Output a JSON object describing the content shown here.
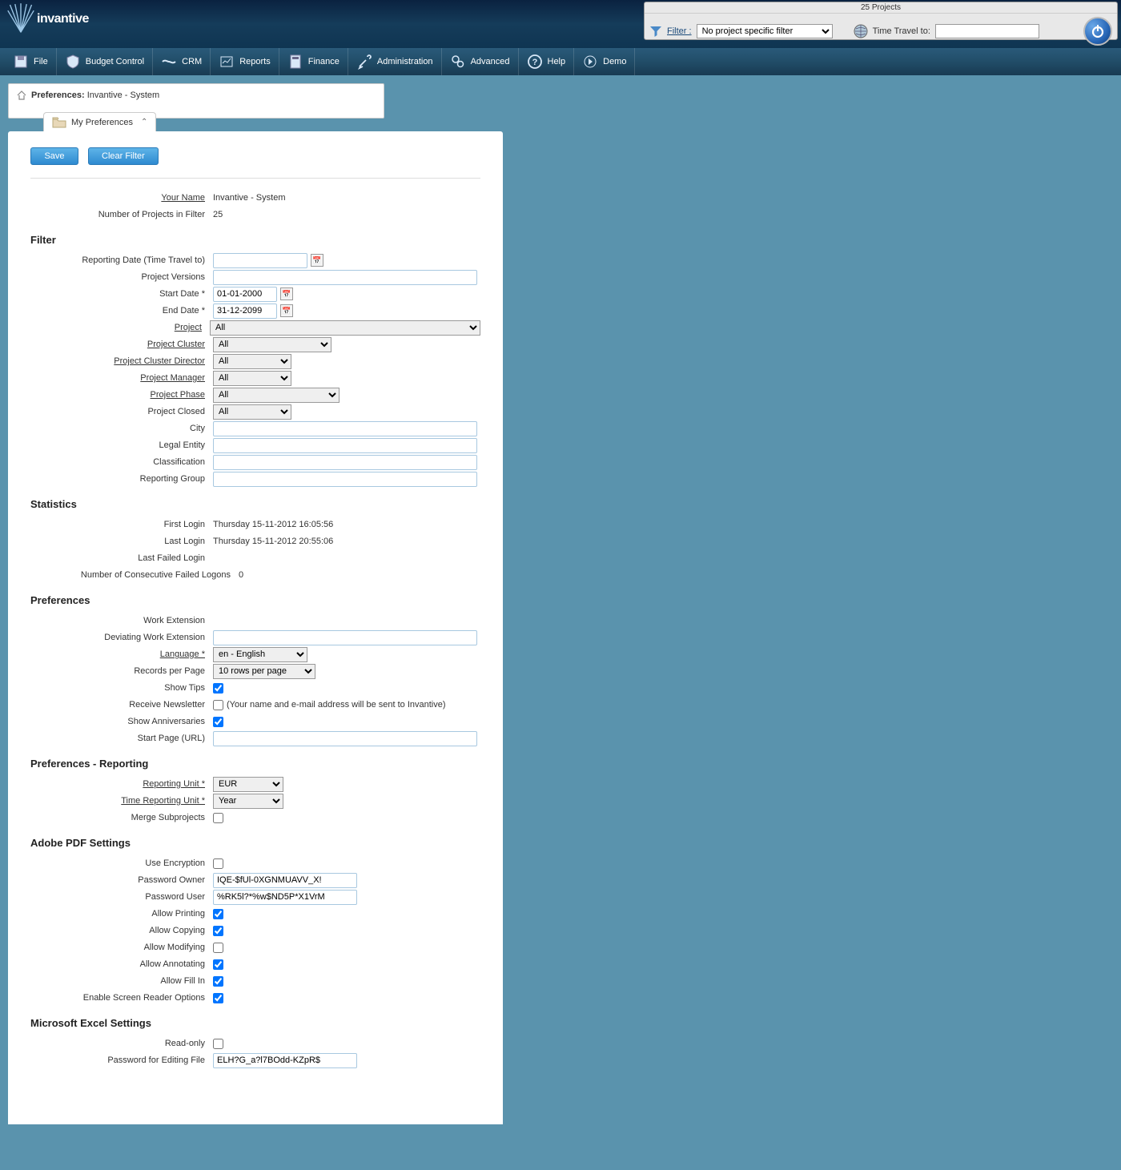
{
  "header": {
    "logo_text": "invantive",
    "projects_count": "25 Projects",
    "filter_label": "Filter :",
    "filter_value": "No project specific filter",
    "time_travel_label": "Time Travel to:",
    "time_travel_value": ""
  },
  "menu": {
    "items": [
      {
        "label": "File"
      },
      {
        "label": "Budget Control"
      },
      {
        "label": "CRM"
      },
      {
        "label": "Reports"
      },
      {
        "label": "Finance"
      },
      {
        "label": "Administration"
      },
      {
        "label": "Advanced"
      },
      {
        "label": "Help"
      },
      {
        "label": "Demo"
      }
    ]
  },
  "breadcrumb": {
    "label": "Preferences:",
    "value": "Invantive - System"
  },
  "tab": {
    "label": "My Preferences"
  },
  "buttons": {
    "save": "Save",
    "clear_filter": "Clear Filter"
  },
  "info": {
    "your_name_label": "Your Name",
    "your_name_value": "Invantive - System",
    "num_projects_label": "Number of Projects in Filter",
    "num_projects_value": "25"
  },
  "sections": {
    "filter": "Filter",
    "statistics": "Statistics",
    "preferences": "Preferences",
    "prefs_reporting": "Preferences - Reporting",
    "pdf": "Adobe PDF Settings",
    "excel": "Microsoft Excel Settings"
  },
  "filter": {
    "reporting_date_label": "Reporting Date (Time Travel to)",
    "reporting_date_value": "",
    "project_versions_label": "Project Versions",
    "project_versions_value": "",
    "start_date_label": "Start Date *",
    "start_date_value": "01-01-2000",
    "end_date_label": "End Date *",
    "end_date_value": "31-12-2099",
    "project_label": "Project",
    "project_value": "All",
    "project_cluster_label": "Project Cluster",
    "project_cluster_value": "All",
    "project_cluster_director_label": "Project Cluster Director",
    "project_cluster_director_value": "All",
    "project_manager_label": "Project Manager",
    "project_manager_value": "All",
    "project_phase_label": "Project Phase",
    "project_phase_value": "All",
    "project_closed_label": "Project Closed",
    "project_closed_value": "All",
    "city_label": "City",
    "city_value": "",
    "legal_entity_label": "Legal Entity",
    "legal_entity_value": "",
    "classification_label": "Classification",
    "classification_value": "",
    "reporting_group_label": "Reporting Group",
    "reporting_group_value": ""
  },
  "statistics": {
    "first_login_label": "First Login",
    "first_login_value": "Thursday 15-11-2012 16:05:56",
    "last_login_label": "Last Login",
    "last_login_value": "Thursday 15-11-2012 20:55:06",
    "last_failed_login_label": "Last Failed Login",
    "last_failed_login_value": "",
    "failed_logons_label": "Number of Consecutive Failed Logons",
    "failed_logons_value": "0"
  },
  "prefs": {
    "work_ext_label": "Work Extension",
    "work_ext_value": "",
    "dev_work_ext_label": "Deviating Work Extension",
    "dev_work_ext_value": "",
    "language_label": "Language *",
    "language_value": "en - English",
    "records_label": "Records per Page",
    "records_value": "10 rows per page",
    "show_tips_label": "Show Tips",
    "receive_newsletter_label": "Receive Newsletter",
    "newsletter_note": "(Your name and e-mail address will be sent to Invantive)",
    "show_anniv_label": "Show Anniversaries",
    "start_page_label": "Start Page (URL)",
    "start_page_value": ""
  },
  "reporting": {
    "reporting_unit_label": "Reporting Unit *",
    "reporting_unit_value": "EUR",
    "time_reporting_unit_label": "Time Reporting Unit *",
    "time_reporting_unit_value": "Year",
    "merge_subprojects_label": "Merge Subprojects"
  },
  "pdf": {
    "use_encryption_label": "Use Encryption",
    "password_owner_label": "Password Owner",
    "password_owner_value": "IQE-$fUl-0XGNMUAVV_X!",
    "password_user_label": "Password User",
    "password_user_value": "%RK5l?*%w$ND5P*X1VrM",
    "allow_printing_label": "Allow Printing",
    "allow_copying_label": "Allow Copying",
    "allow_modifying_label": "Allow Modifying",
    "allow_annotating_label": "Allow Annotating",
    "allow_fillin_label": "Allow Fill In",
    "enable_screen_reader_label": "Enable Screen Reader Options"
  },
  "excel": {
    "readonly_label": "Read-only",
    "password_label": "Password for Editing File",
    "password_value": "ELH?G_a?l7BOdd-KZpR$"
  }
}
